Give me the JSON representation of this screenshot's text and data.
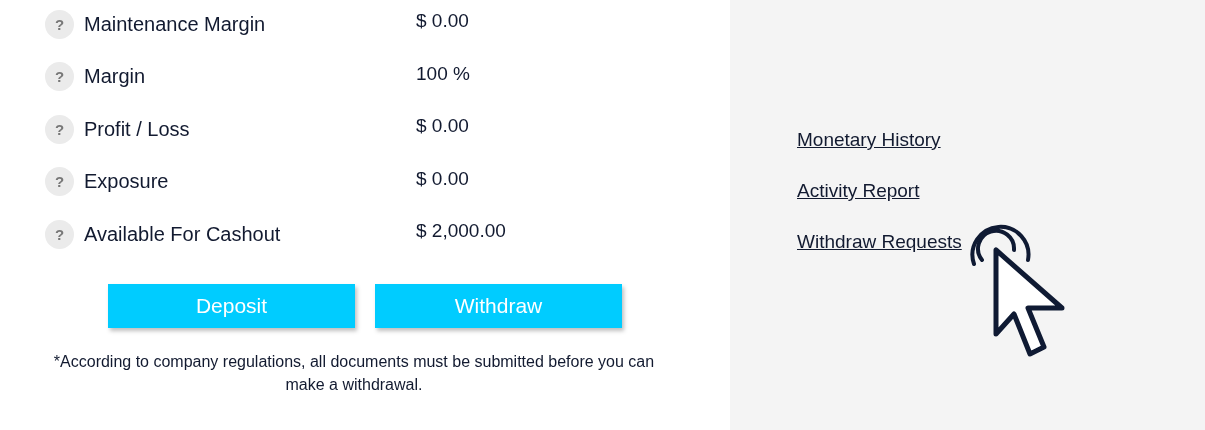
{
  "summary": [
    {
      "label": "Maintenance Margin",
      "value": "$ 0.00",
      "help": "?"
    },
    {
      "label": "Margin",
      "value": "100 %",
      "help": "?"
    },
    {
      "label": "Profit / Loss",
      "value": "$ 0.00",
      "help": "?"
    },
    {
      "label": "Exposure",
      "value": "$ 0.00",
      "help": "?"
    },
    {
      "label": "Available For Cashout",
      "value": "$ 2,000.00",
      "help": "?"
    }
  ],
  "buttons": [
    "Deposit",
    "Withdraw"
  ],
  "note": "*According to company regulations, all documents must be submitted before you can make a withdrawal.",
  "links": [
    "Monetary History",
    "Activity Report",
    "Withdraw Requests"
  ]
}
